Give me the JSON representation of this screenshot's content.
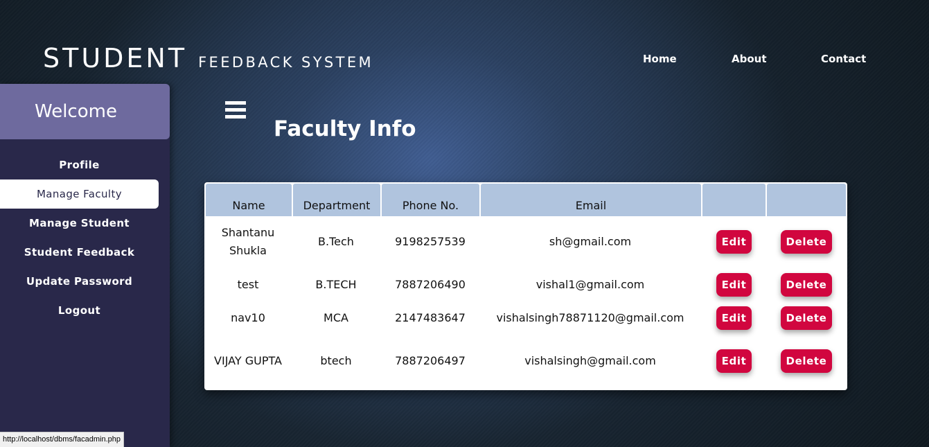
{
  "header": {
    "brand_big": "STUDENT",
    "brand_small": "FEEDBACK SYSTEM",
    "nav": [
      "Home",
      "About",
      "Contact"
    ]
  },
  "sidebar": {
    "welcome": "Welcome",
    "items": [
      "Profile",
      "Manage Faculty",
      "Manage Student",
      "Student Feedback",
      "Update Password",
      "Logout"
    ],
    "active_index": 1
  },
  "main": {
    "menu_icon": "hamburger-icon",
    "title": "Faculty Info",
    "table": {
      "headers": [
        "Name",
        "Department",
        "Phone No.",
        "Email",
        "",
        ""
      ],
      "rows": [
        {
          "name": "Shantanu Shukla",
          "department": "B.Tech",
          "phone": "9198257539",
          "email": "sh@gmail.com",
          "edit": "Edit",
          "delete": "Delete"
        },
        {
          "name": "test",
          "department": "B.TECH",
          "phone": "7887206490",
          "email": "vishal1@gmail.com",
          "edit": "Edit",
          "delete": "Delete"
        },
        {
          "name": "nav10",
          "department": "MCA",
          "phone": "2147483647",
          "email": "vishalsingh78871120@gmail.com",
          "edit": "Edit",
          "delete": "Delete"
        },
        {
          "name": "VIJAY GUPTA",
          "department": "btech",
          "phone": "7887206497",
          "email": "vishalsingh@gmail.com",
          "edit": "Edit",
          "delete": "Delete"
        }
      ]
    }
  },
  "statusbar": {
    "url": "http://localhost/dbms/facadmin.php"
  },
  "colors": {
    "sidebar_bg": "#29284a",
    "welcome_bg": "#6e6a9e",
    "table_header_bg": "#b0c4de",
    "action_button_bg": "#d1063f"
  }
}
